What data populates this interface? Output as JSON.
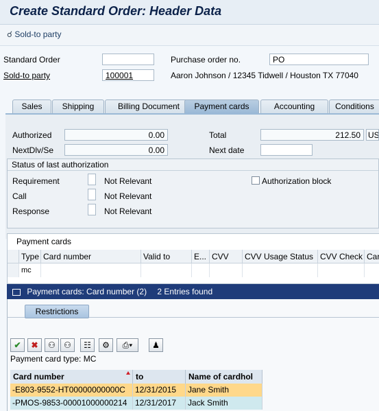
{
  "window": {
    "title": "Create Standard Order: Header Data"
  },
  "appbar": {
    "sold_to_button": "Sold-to party"
  },
  "header": {
    "standard_order_label": "Standard Order",
    "standard_order_value": "",
    "po_label": "Purchase order no.",
    "po_value": "PO",
    "sold_to_label": "Sold-to party",
    "sold_to_value": "100001",
    "sold_to_desc": "Aaron Johnson / 12345 Tidwell / Houston TX 77040"
  },
  "tabs": [
    "Sales",
    "Shipping",
    "Billing Document",
    "Payment cards",
    "Accounting",
    "Conditions"
  ],
  "auth": {
    "authorized_label": "Authorized",
    "authorized_value": "0.00",
    "nextdl_label": "NextDlv/Se",
    "nextdl_value": "0.00",
    "total_label": "Total",
    "total_value": "212.50",
    "currency": "USD",
    "next_date_label": "Next date",
    "next_date_value": ""
  },
  "status_group": {
    "title": "Status of last authorization",
    "rows": [
      {
        "label": "Requirement",
        "value": "Not Relevant"
      },
      {
        "label": "Call",
        "value": "Not Relevant"
      },
      {
        "label": "Response",
        "value": "Not Relevant"
      }
    ],
    "auth_block_label": "Authorization block"
  },
  "payment_table": {
    "caption": "Payment cards",
    "columns": [
      "Type",
      "Card number",
      "Valid to",
      "E...",
      "CVV",
      "CVV Usage Status",
      "CVV Check",
      "Card"
    ],
    "row1_type": "mc"
  },
  "popup": {
    "title": "Payment cards: Card number (2)",
    "entries": "2 Entries found",
    "restrictions_tab": "Restrictions",
    "card_type_line": "Payment card type: MC",
    "columns": [
      "Card number",
      "to",
      "Name of cardhol"
    ],
    "rows": [
      {
        "card": "-E803-9552-HT00000000000C",
        "to": "12/31/2015",
        "name": "Jane Smith"
      },
      {
        "card": "-PMOS-9853-00001000000214",
        "to": "12/31/2017",
        "name": "Jack Smith"
      }
    ]
  },
  "colors": {
    "title_blue": "#0b2149",
    "popup_bar": "#1f3c7a",
    "row_selected": "#ffd88a",
    "row_alt": "#cfe9ee"
  }
}
